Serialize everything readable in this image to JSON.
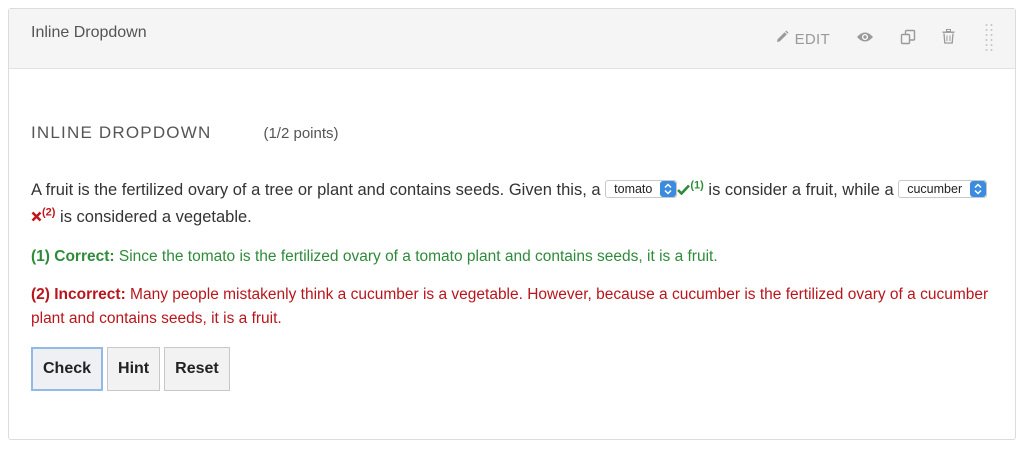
{
  "header": {
    "title": "Inline Dropdown",
    "edit_label": "EDIT"
  },
  "problem": {
    "title": "INLINE DROPDOWN",
    "points": "(1/2 points)",
    "text_1": "A fruit is the fertilized ovary of a tree or plant and contains seeds. Given this, a ",
    "select_1": "tomato",
    "marker_1": "(1)",
    "text_2": " is consider a fruit, while a ",
    "select_2": "cucumber",
    "marker_2": "(2)",
    "text_3": " is considered a vegetable."
  },
  "feedback": {
    "correct_label": "(1) Correct:",
    "correct_text": " Since the tomato is the fertilized ovary of a tomato plant and contains seeds, it is a fruit.",
    "incorrect_label": "(2) Incorrect:",
    "incorrect_text": " Many people mistakenly think a cucumber is a vegetable. However, because a cucumber is the fertilized ovary of a cucumber plant and contains seeds, it is a fruit."
  },
  "buttons": {
    "check": "Check",
    "hint": "Hint",
    "reset": "Reset"
  },
  "colors": {
    "correct": "#2e8b3a",
    "incorrect": "#c0161c",
    "select_accent": "#3b8be0"
  },
  "icons": [
    "pencil-icon",
    "eye-icon",
    "duplicate-icon",
    "trash-icon",
    "drag-handle-icon",
    "checkmark-icon",
    "cross-icon",
    "select-arrows-icon"
  ]
}
